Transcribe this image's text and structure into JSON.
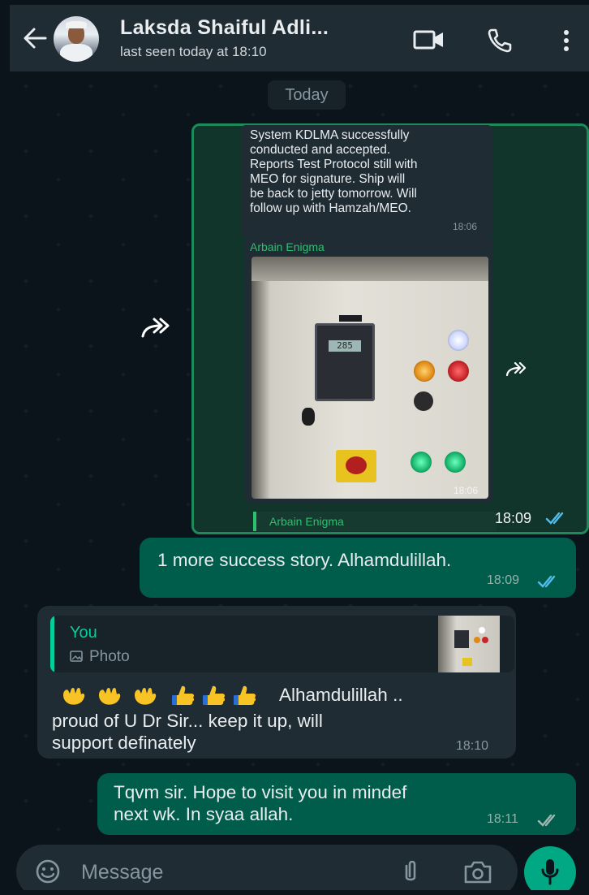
{
  "header": {
    "contact_name": "Laksda Shaiful Adli...",
    "status": "last seen today at 18:10"
  },
  "date_chip": "Today",
  "forwarded_group": {
    "text_message": "System KDLMA successfully\nconducted and accepted.\nReports Test Protocol still with\nMEO for signature. Ship will\nbe back to jetty tomorrow. Will\nfollow up with Hamzah/MEO.",
    "text_time": "18:06",
    "photo_sender": "Arbain Enigma",
    "photo_time": "18:06",
    "meter_reading": "285",
    "reply_sender": "Arbain Enigma",
    "group_time": "18:09"
  },
  "messages": [
    {
      "direction": "out",
      "text": "1 more success story. Alhamdulillah.",
      "time": "18:09",
      "status": "read"
    },
    {
      "direction": "in",
      "quote_name": "You",
      "quote_type": "Photo",
      "text_after_emoji": "Alhamdulillah ..",
      "text": "proud of U Dr Sir... keep it up, will\nsupport definately",
      "time": "18:10"
    },
    {
      "direction": "out",
      "text": "Tqvm sir. Hope to visit you in mindef\nnext wk. In syaa allah.",
      "time": "18:11",
      "status": "delivered"
    }
  ],
  "input": {
    "placeholder": "Message"
  },
  "colors": {
    "accent": "#00a884",
    "outgoing_bubble": "#005c4b",
    "incoming_bubble": "#1f2c34",
    "read_tick": "#53bdeb"
  }
}
